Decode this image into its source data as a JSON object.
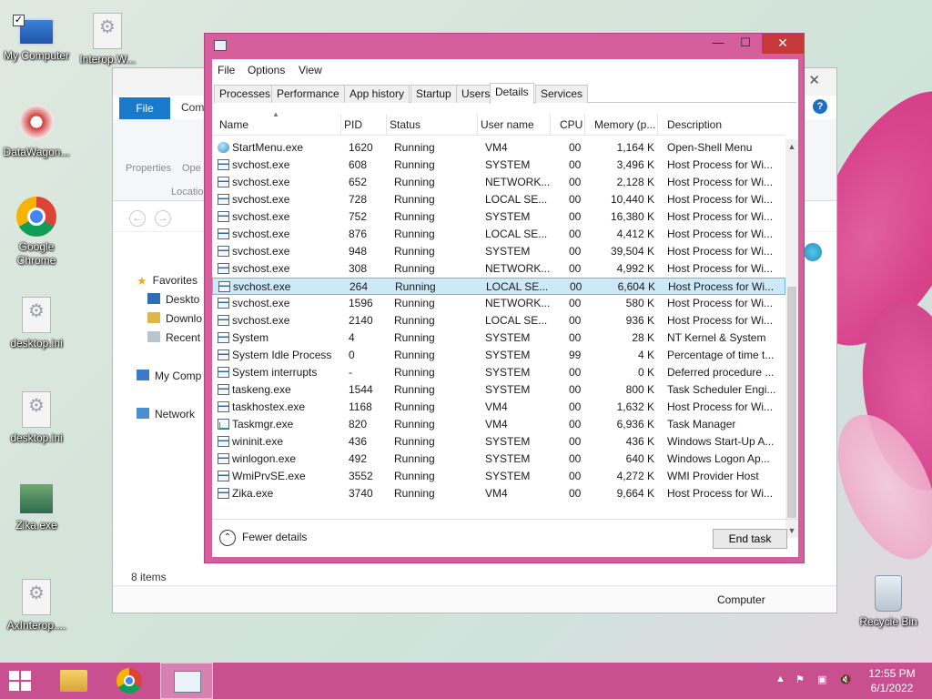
{
  "desktop": {
    "icons": [
      {
        "label": "My Computer"
      },
      {
        "label": "Interop.W..."
      },
      {
        "label": "DataWagon..."
      },
      {
        "label": "Google Chrome"
      },
      {
        "label": "desktop.ini"
      },
      {
        "label": "desktop.ini"
      },
      {
        "label": "Zika.exe"
      },
      {
        "label": "AxInterop...."
      },
      {
        "label": "Recycle Bin"
      }
    ]
  },
  "explorer": {
    "file_tab": "File",
    "comp_tab": "Com",
    "ribbon": {
      "properties": "Properties",
      "open": "Ope",
      "location": "Locatio"
    },
    "tree": {
      "favorites": "Favorites",
      "desktop": "Deskto",
      "downloads": "Downlo",
      "recent": "Recent p",
      "my_computer": "My Comp",
      "network": "Network"
    },
    "items_count": "8 items",
    "status_computer": "Computer"
  },
  "taskmanager": {
    "menu": {
      "file": "File",
      "options": "Options",
      "view": "View"
    },
    "tabs": [
      "Processes",
      "Performance",
      "App history",
      "Startup",
      "Users",
      "Details",
      "Services"
    ],
    "active_tab": "Details",
    "columns": [
      "Name",
      "PID",
      "Status",
      "User name",
      "CPU",
      "Memory (p...",
      "Description"
    ],
    "rows": [
      {
        "name": "StartMenu.exe",
        "pid": "1620",
        "status": "Running",
        "user": "VM4",
        "cpu": "00",
        "mem": "1,164 K",
        "desc": "Open-Shell Menu",
        "icon": "globe"
      },
      {
        "name": "svchost.exe",
        "pid": "608",
        "status": "Running",
        "user": "SYSTEM",
        "cpu": "00",
        "mem": "3,496 K",
        "desc": "Host Process for Wi...",
        "icon": "win"
      },
      {
        "name": "svchost.exe",
        "pid": "652",
        "status": "Running",
        "user": "NETWORK...",
        "cpu": "00",
        "mem": "2,128 K",
        "desc": "Host Process for Wi...",
        "icon": "win"
      },
      {
        "name": "svchost.exe",
        "pid": "728",
        "status": "Running",
        "user": "LOCAL SE...",
        "cpu": "00",
        "mem": "10,440 K",
        "desc": "Host Process for Wi...",
        "icon": "win"
      },
      {
        "name": "svchost.exe",
        "pid": "752",
        "status": "Running",
        "user": "SYSTEM",
        "cpu": "00",
        "mem": "16,380 K",
        "desc": "Host Process for Wi...",
        "icon": "win"
      },
      {
        "name": "svchost.exe",
        "pid": "876",
        "status": "Running",
        "user": "LOCAL SE...",
        "cpu": "00",
        "mem": "4,412 K",
        "desc": "Host Process for Wi...",
        "icon": "win"
      },
      {
        "name": "svchost.exe",
        "pid": "948",
        "status": "Running",
        "user": "SYSTEM",
        "cpu": "00",
        "mem": "39,504 K",
        "desc": "Host Process for Wi...",
        "icon": "win"
      },
      {
        "name": "svchost.exe",
        "pid": "308",
        "status": "Running",
        "user": "NETWORK...",
        "cpu": "00",
        "mem": "4,992 K",
        "desc": "Host Process for Wi...",
        "icon": "win"
      },
      {
        "name": "svchost.exe",
        "pid": "264",
        "status": "Running",
        "user": "LOCAL SE...",
        "cpu": "00",
        "mem": "6,604 K",
        "desc": "Host Process for Wi...",
        "icon": "win",
        "selected": true
      },
      {
        "name": "svchost.exe",
        "pid": "1596",
        "status": "Running",
        "user": "NETWORK...",
        "cpu": "00",
        "mem": "580 K",
        "desc": "Host Process for Wi...",
        "icon": "win"
      },
      {
        "name": "svchost.exe",
        "pid": "2140",
        "status": "Running",
        "user": "LOCAL SE...",
        "cpu": "00",
        "mem": "936 K",
        "desc": "Host Process for Wi...",
        "icon": "win"
      },
      {
        "name": "System",
        "pid": "4",
        "status": "Running",
        "user": "SYSTEM",
        "cpu": "00",
        "mem": "28 K",
        "desc": "NT Kernel & System",
        "icon": "win"
      },
      {
        "name": "System Idle Process",
        "pid": "0",
        "status": "Running",
        "user": "SYSTEM",
        "cpu": "99",
        "mem": "4 K",
        "desc": "Percentage of time t...",
        "icon": "win"
      },
      {
        "name": "System interrupts",
        "pid": "-",
        "status": "Running",
        "user": "SYSTEM",
        "cpu": "00",
        "mem": "0 K",
        "desc": "Deferred procedure ...",
        "icon": "win"
      },
      {
        "name": "taskeng.exe",
        "pid": "1544",
        "status": "Running",
        "user": "SYSTEM",
        "cpu": "00",
        "mem": "800 K",
        "desc": "Task Scheduler Engi...",
        "icon": "win"
      },
      {
        "name": "taskhostex.exe",
        "pid": "1168",
        "status": "Running",
        "user": "VM4",
        "cpu": "00",
        "mem": "1,632 K",
        "desc": "Host Process for Wi...",
        "icon": "win"
      },
      {
        "name": "Taskmgr.exe",
        "pid": "820",
        "status": "Running",
        "user": "VM4",
        "cpu": "00",
        "mem": "6,936 K",
        "desc": "Task Manager",
        "icon": "chart"
      },
      {
        "name": "wininit.exe",
        "pid": "436",
        "status": "Running",
        "user": "SYSTEM",
        "cpu": "00",
        "mem": "436 K",
        "desc": "Windows Start-Up A...",
        "icon": "win"
      },
      {
        "name": "winlogon.exe",
        "pid": "492",
        "status": "Running",
        "user": "SYSTEM",
        "cpu": "00",
        "mem": "640 K",
        "desc": "Windows Logon Ap...",
        "icon": "win"
      },
      {
        "name": "WmiPrvSE.exe",
        "pid": "3552",
        "status": "Running",
        "user": "SYSTEM",
        "cpu": "00",
        "mem": "4,272 K",
        "desc": "WMI Provider Host",
        "icon": "win"
      },
      {
        "name": "Zika.exe",
        "pid": "3740",
        "status": "Running",
        "user": "VM4",
        "cpu": "00",
        "mem": "9,664 K",
        "desc": "Host Process for Wi...",
        "icon": "win"
      }
    ],
    "fewer_details": "Fewer details",
    "end_task": "End task"
  },
  "taskbar": {
    "time": "12:55 PM",
    "date": "6/1/2022"
  },
  "colors": {
    "window_frame": "#d55f9d",
    "taskbar": "#c95090",
    "selection": "#cde8f7",
    "close_button": "#c7383a"
  }
}
